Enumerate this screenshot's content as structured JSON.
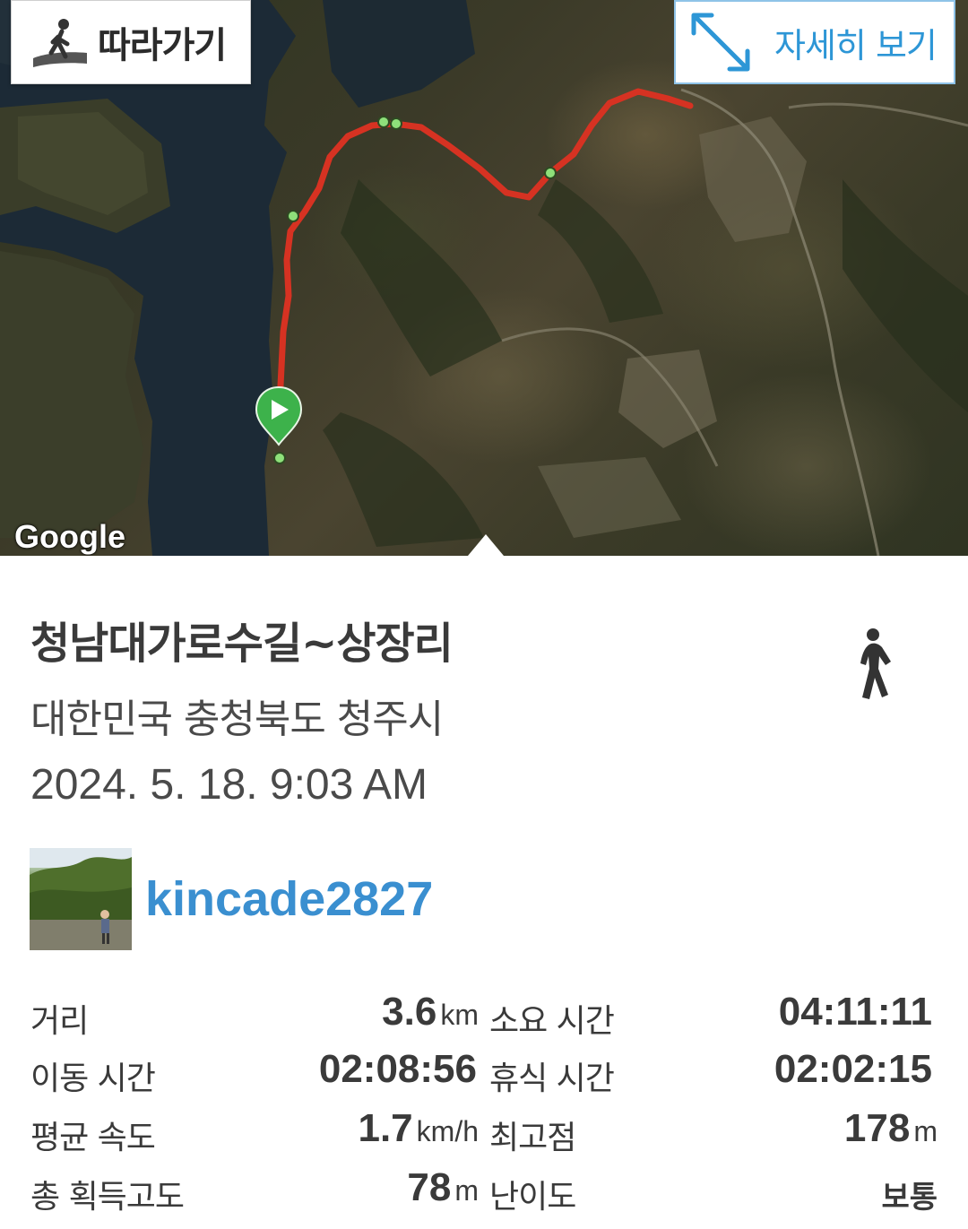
{
  "map": {
    "follow_button": {
      "label": "따라가기",
      "icon": "follow-walker-icon"
    },
    "detail_button": {
      "label": "자세히 보기",
      "icon": "expand-arrows-icon"
    },
    "attribution": "Google",
    "route_color": "#d63222",
    "waypoint_color": "#8ee07a",
    "start_marker_color": "#3db24b"
  },
  "track": {
    "title": "청남대가로수길~상장리",
    "location": "대한민국 충청북도 청주시",
    "datetime": "2024. 5. 18. 9:03 AM",
    "activity_icon": "walking-icon"
  },
  "user": {
    "name": "kincade2827",
    "name_color": "#3a8fd0"
  },
  "stats": {
    "distance": {
      "label": "거리",
      "value": "3.6",
      "unit": "km"
    },
    "total_time": {
      "label": "소요 시간",
      "value": "04:11:11",
      "unit": ""
    },
    "moving_time": {
      "label": "이동 시간",
      "value": "02:08:56",
      "unit": ""
    },
    "rest_time": {
      "label": "휴식 시간",
      "value": "02:02:15",
      "unit": ""
    },
    "avg_speed": {
      "label": "평균 속도",
      "value": "1.7",
      "unit": "km/h"
    },
    "max_elevation": {
      "label": "최고점",
      "value": "178",
      "unit": "m"
    },
    "elevation_gain": {
      "label": "총 획득고도",
      "value": "78",
      "unit": "m"
    },
    "difficulty": {
      "label": "난이도",
      "value": "보통",
      "unit": ""
    }
  }
}
